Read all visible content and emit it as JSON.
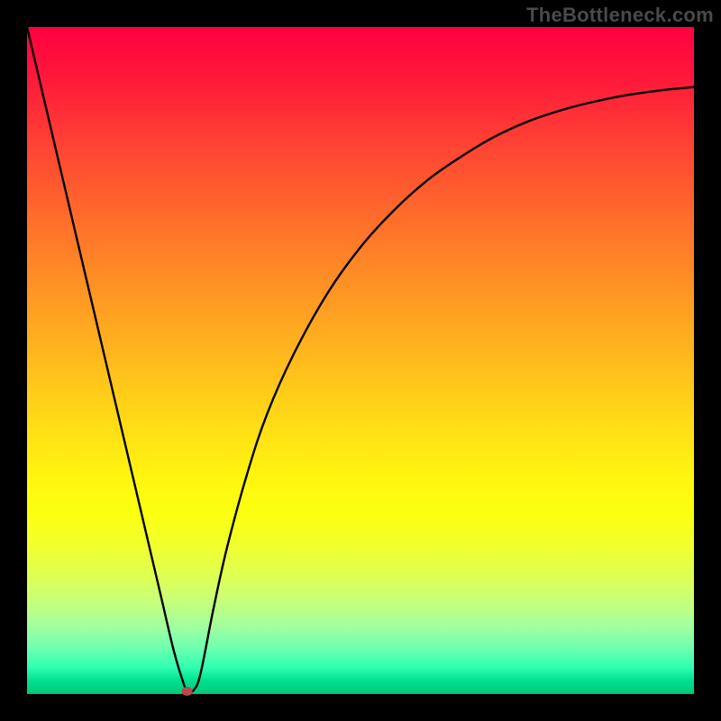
{
  "watermark": "TheBottleneck.com",
  "chart_data": {
    "type": "line",
    "title": "",
    "xlabel": "",
    "ylabel": "",
    "xlim": [
      0,
      100
    ],
    "ylim": [
      0,
      100
    ],
    "grid": false,
    "legend": false,
    "gradient_colors": {
      "top": "#ff0040",
      "middle": "#ffd717",
      "bottom": "#00c878"
    },
    "series": [
      {
        "name": "bottleneck-curve",
        "x": [
          0,
          2,
          4,
          6,
          8,
          10,
          12,
          14,
          16,
          18,
          20,
          22,
          23.5,
          24,
          24.5,
          25,
          26,
          28,
          30,
          33,
          36,
          40,
          45,
          50,
          55,
          60,
          65,
          70,
          75,
          80,
          85,
          90,
          95,
          100
        ],
        "y": [
          100,
          91.5,
          83,
          74.5,
          66,
          57.5,
          49,
          40.5,
          32,
          23.5,
          15,
          6.5,
          1.5,
          0.6,
          0.4,
          0.6,
          3,
          13,
          22,
          33,
          42,
          51,
          60,
          67,
          72.5,
          77,
          80.5,
          83.5,
          85.8,
          87.5,
          88.8,
          89.8,
          90.5,
          91
        ]
      }
    ],
    "marker": {
      "x": 24,
      "y": 0.4,
      "color": "#b74a4a"
    }
  }
}
